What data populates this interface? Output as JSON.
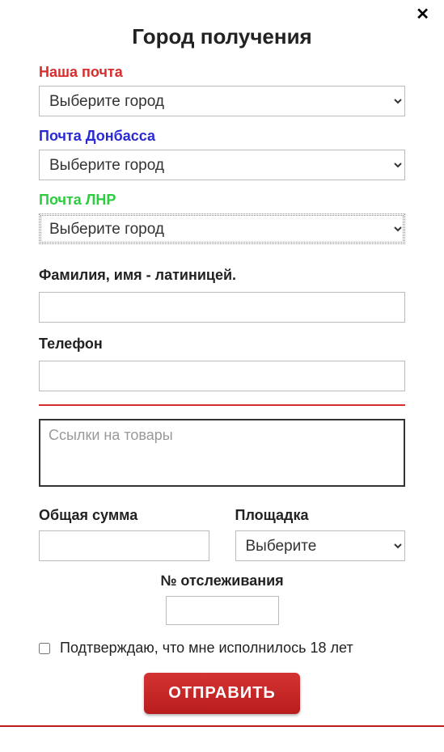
{
  "close_icon": "✕",
  "title": "Город получения",
  "sections": {
    "nasha_pochta": {
      "label": "Наша почта",
      "selected": "Выберите город"
    },
    "pochta_donbassa": {
      "label": "Почта Донбасса",
      "selected": "Выберите город"
    },
    "pochta_lnr": {
      "label": "Почта ЛНР",
      "selected": "Выберите город"
    }
  },
  "fields": {
    "fullname_label": "Фамилия, имя - латиницей.",
    "fullname_value": "",
    "phone_label": "Телефон",
    "phone_value": "",
    "links_placeholder": "Ссылки на товары",
    "links_value": "",
    "total_label": "Общая сумма",
    "total_value": "",
    "platform_label": "Площадка",
    "platform_selected": "Выберите",
    "tracking_label": "№ отслеживания",
    "tracking_value": ""
  },
  "confirm": {
    "checked": false,
    "label": "Подтверждаю, что мне исполнилось 18 лет"
  },
  "submit_label": "ОТПРАВИТЬ"
}
